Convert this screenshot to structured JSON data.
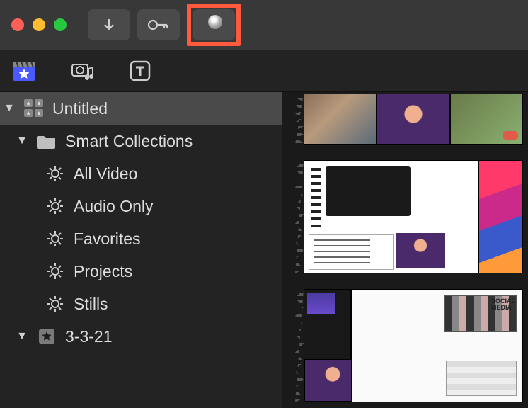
{
  "titlebar": {
    "buttons": {
      "import": "import",
      "keyword": "keyword",
      "background": "background-tasks"
    }
  },
  "tabs": {
    "media": "media",
    "audio": "audio-music",
    "titles": "titles"
  },
  "sidebar": {
    "library": {
      "name": "Untitled"
    },
    "smart_collections": {
      "label": "Smart Collections",
      "items": [
        {
          "label": "All Video"
        },
        {
          "label": "Audio Only"
        },
        {
          "label": "Favorites"
        },
        {
          "label": "Projects"
        },
        {
          "label": "Stills"
        }
      ]
    },
    "events": [
      {
        "label": "3-3-21"
      }
    ]
  },
  "browser": {
    "clips": [
      {
        "id": "clip-1",
        "thumbs": 3
      },
      {
        "id": "clip-2",
        "thumbs": 2
      },
      {
        "id": "clip-3",
        "thumbs": 2
      }
    ]
  },
  "highlight": {
    "target": "background-tasks-button",
    "color": "#ff5a3d"
  }
}
